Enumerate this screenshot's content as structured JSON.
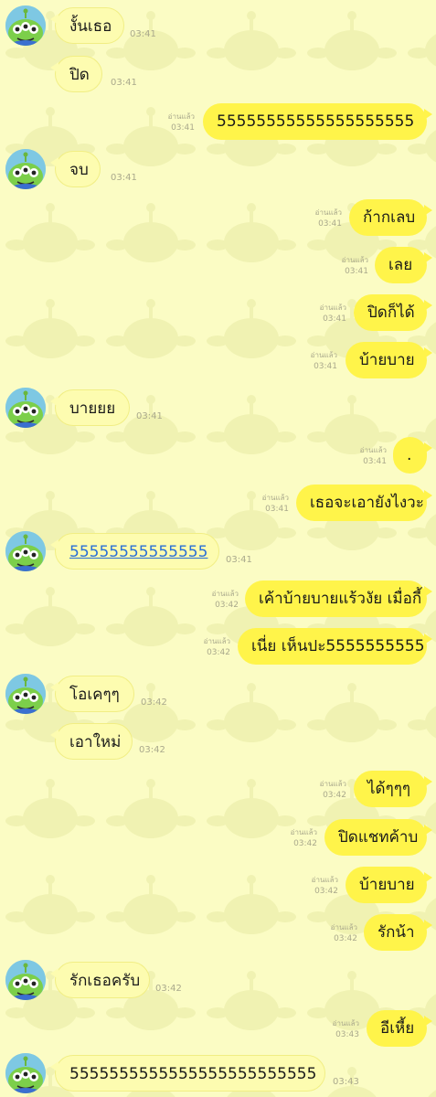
{
  "chat": {
    "messages": [
      {
        "side": "in",
        "avatar": true,
        "text": "งั้นเธอ",
        "time": "03:41"
      },
      {
        "side": "in",
        "avatar": false,
        "text": "ปิด",
        "time": "03:41"
      },
      {
        "side": "out",
        "text": "55555555555555555555",
        "read": "อ่านแล้ว",
        "time": "03:41"
      },
      {
        "side": "in",
        "avatar": true,
        "text": "จบ",
        "time": "03:41"
      },
      {
        "side": "out",
        "text": "ก้ากเลบ",
        "read": "อ่านแล้ว",
        "time": "03:41"
      },
      {
        "side": "out",
        "text": "เลย",
        "read": "อ่านแล้ว",
        "time": "03:41"
      },
      {
        "side": "out",
        "text": "ปิดก็ได้",
        "read": "อ่านแล้ว",
        "time": "03:41"
      },
      {
        "side": "out",
        "text": "บ้ายบาย",
        "read": "อ่านแล้ว",
        "time": "03:41"
      },
      {
        "side": "in",
        "avatar": true,
        "text": "บายยย",
        "time": "03:41"
      },
      {
        "side": "out",
        "text": ".",
        "read": "อ่านแล้ว",
        "time": "03:41"
      },
      {
        "side": "out",
        "text": "เธอจะเอายังไงวะ",
        "read": "อ่านแล้ว",
        "time": "03:41"
      },
      {
        "side": "in",
        "avatar": true,
        "text": "55555555555555",
        "time": "03:41",
        "link": true
      },
      {
        "side": "out",
        "text": "เค้าบ้ายบายแร้วงัย เมื่อกี้",
        "read": "อ่านแล้ว",
        "time": "03:42"
      },
      {
        "side": "out",
        "text": "เนี่ย เห็นปะ5555555555",
        "read": "อ่านแล้ว",
        "time": "03:42"
      },
      {
        "side": "in",
        "avatar": true,
        "text": "โอเคๆๆ",
        "time": "03:42"
      },
      {
        "side": "in",
        "avatar": false,
        "text": "เอาใหม่",
        "time": "03:42"
      },
      {
        "side": "out",
        "text": "ได้ๆๆๆ",
        "read": "อ่านแล้ว",
        "time": "03:42"
      },
      {
        "side": "out",
        "text": "ปิดแชทค้าบ",
        "read": "อ่านแล้ว",
        "time": "03:42"
      },
      {
        "side": "out",
        "text": "บ้ายบาย",
        "read": "อ่านแล้ว",
        "time": "03:42"
      },
      {
        "side": "out",
        "text": "รักน้า",
        "read": "อ่านแล้ว",
        "time": "03:42"
      },
      {
        "side": "in",
        "avatar": true,
        "text": "รักเธอครับ",
        "time": "03:42"
      },
      {
        "side": "out",
        "text": "อีเหี้ย",
        "read": "อ่านแล้ว",
        "time": "03:43"
      },
      {
        "side": "in",
        "avatar": true,
        "text": "5555555555555555555555555",
        "time": "03:43"
      }
    ]
  },
  "colors": {
    "background": "#fbfcc4",
    "bubble_in": "#fdfcb0",
    "bubble_out": "#fff44a",
    "link": "#2a6fd6"
  },
  "icons": {
    "avatar": "alien-avatar-icon"
  }
}
